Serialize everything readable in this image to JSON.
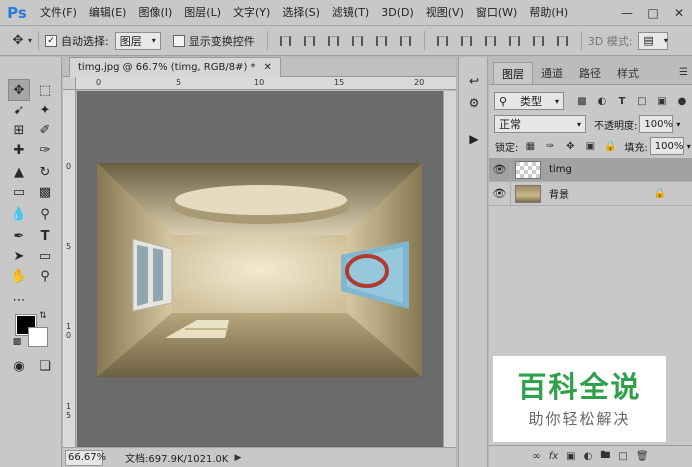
{
  "app": {
    "logo": "Ps"
  },
  "menu": [
    "文件(F)",
    "编辑(E)",
    "图像(I)",
    "图层(L)",
    "文字(Y)",
    "选择(S)",
    "滤镜(T)",
    "3D(D)",
    "视图(V)",
    "窗口(W)",
    "帮助(H)"
  ],
  "window_controls": [
    "minimize-icon",
    "restore-icon",
    "close-icon"
  ],
  "options": {
    "auto_select_label": "自动选择:",
    "auto_select_checked": true,
    "auto_select_value": "图层",
    "show_transform_label": "显示变换控件",
    "show_transform_checked": false,
    "mode_3d_label": "3D 模式:"
  },
  "document": {
    "tab_title": "timg.jpg @ 66.7% (timg, RGB/8#) *",
    "ruler_top": [
      "0",
      "5",
      "10",
      "15",
      "20"
    ],
    "ruler_left": [
      "0",
      "5",
      "1 0",
      "1 5"
    ],
    "zoom": "66.67%",
    "doc_info": "文档:697.9K/1021.0K"
  },
  "layers_panel": {
    "tabs": [
      "图层",
      "通道",
      "路径",
      "样式"
    ],
    "active_tab": 0,
    "filter_kind": "类型",
    "blend_mode": "正常",
    "opacity_label": "不透明度:",
    "opacity_value": "100%",
    "lock_label": "锁定:",
    "fill_label": "填充:",
    "fill_value": "100%",
    "layers": [
      {
        "name": "timg",
        "selected": true,
        "locked": false
      },
      {
        "name": "背景",
        "selected": false,
        "locked": true
      }
    ]
  },
  "watermark": {
    "title": "百科全说",
    "subtitle": "助你轻松解决"
  }
}
